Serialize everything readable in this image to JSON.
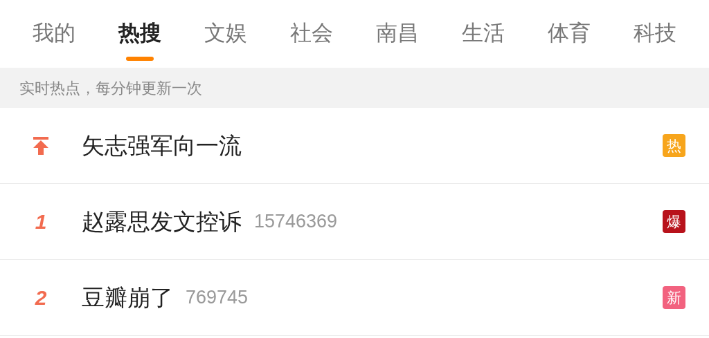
{
  "tabs": [
    {
      "label": "我的",
      "selected": false
    },
    {
      "label": "热搜",
      "selected": true
    },
    {
      "label": "文娱",
      "selected": false
    },
    {
      "label": "社会",
      "selected": false
    },
    {
      "label": "南昌",
      "selected": false
    },
    {
      "label": "生活",
      "selected": false
    },
    {
      "label": "体育",
      "selected": false
    },
    {
      "label": "科技",
      "selected": false
    }
  ],
  "banner": "实时热点，每分钟更新一次",
  "rows": [
    {
      "kind": "pinned",
      "title": "矢志强军向一流",
      "badge": {
        "label": "热",
        "color": "#f7a51c"
      }
    },
    {
      "kind": "rank",
      "rank": "1",
      "title": "赵露思发文控诉",
      "count": "15746369",
      "badge": {
        "label": "爆",
        "color": "#b8121b"
      }
    },
    {
      "kind": "rank",
      "rank": "2",
      "title": "豆瓣崩了",
      "count": "769745",
      "badge": {
        "label": "新",
        "color": "#f2627f"
      }
    }
  ]
}
